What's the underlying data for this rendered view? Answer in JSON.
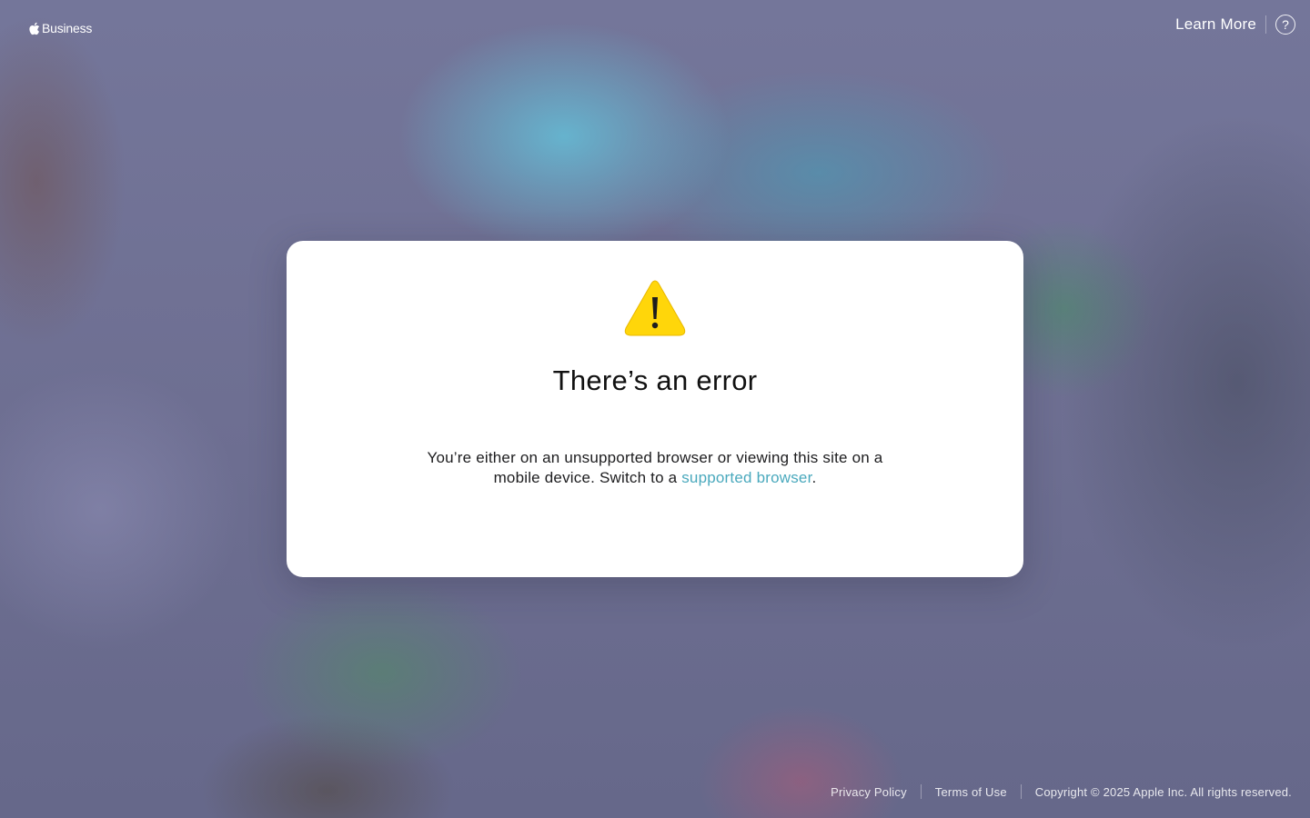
{
  "header": {
    "brand_text": "Business",
    "learn_more_label": "Learn More",
    "help_icon_glyph": "?"
  },
  "modal": {
    "icon": "warning-triangle-icon",
    "icon_color": "#FFD60A",
    "title": "There’s an error",
    "body_prefix": "You’re either on an unsupported browser or viewing this site on a mobile device. Switch to a ",
    "body_link": "supported browser",
    "body_suffix": ".",
    "link_color": "#4AA9BD"
  },
  "footer": {
    "privacy_label": "Privacy Policy",
    "terms_label": "Terms of Use",
    "copyright": "Copyright © 2025 Apple Inc. All rights reserved."
  }
}
